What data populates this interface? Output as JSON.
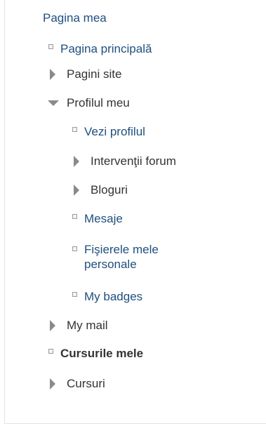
{
  "navigation": {
    "root_label": "Pagina mea",
    "items": {
      "home": {
        "label": "Pagina principală",
        "icon": "leaf-square-icon"
      },
      "site_pages": {
        "label": "Pagini site",
        "icon": "chevron-right-icon"
      },
      "my_profile": {
        "label": "Profilul meu",
        "icon": "chevron-down-icon"
      },
      "view_profile": {
        "label": "Vezi profilul",
        "icon": "leaf-square-icon"
      },
      "forum_posts": {
        "label": "Intervenţii forum",
        "icon": "chevron-right-icon"
      },
      "blogs": {
        "label": "Bloguri",
        "icon": "chevron-right-icon"
      },
      "messages": {
        "label": "Mesaje",
        "icon": "leaf-square-icon"
      },
      "private_files": {
        "label": "Fişierele mele personale",
        "icon": "leaf-square-icon"
      },
      "my_badges": {
        "label": "My badges",
        "icon": "leaf-square-icon"
      },
      "my_mail": {
        "label": "My mail",
        "icon": "chevron-right-icon"
      },
      "my_courses": {
        "label": "Cursurile mele",
        "icon": "leaf-square-icon"
      },
      "courses": {
        "label": "Cursuri",
        "icon": "chevron-right-icon"
      }
    }
  },
  "colors": {
    "link": "#1f4f7d",
    "text": "#333333",
    "caret": "#8a8a8a",
    "border": "#e2e2e2"
  }
}
